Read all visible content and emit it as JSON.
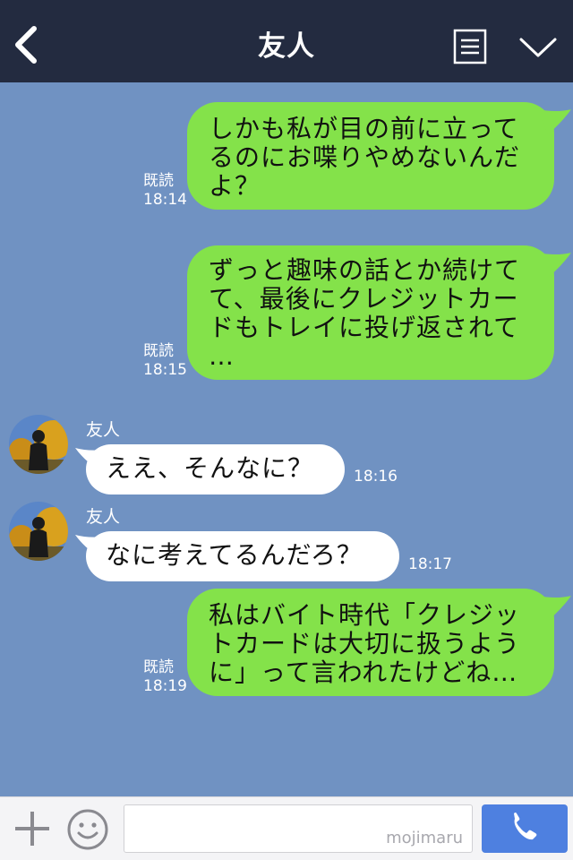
{
  "header": {
    "title": "友人"
  },
  "messages": [
    {
      "type": "sent",
      "text": "しかも私が目の前に立って\nるのにお喋りやめないんだ\nよ？",
      "read": "既読",
      "time": "18:14"
    },
    {
      "type": "sent",
      "text": "ずっと趣味の話とか続けて\nて、最後にクレジットカー\nドもトレイに投げ返されて\n…",
      "read": "既読",
      "time": "18:15"
    },
    {
      "type": "received",
      "sender": "友人",
      "text": "ええ、そんなに？",
      "time": "18:16"
    },
    {
      "type": "received",
      "sender": "友人",
      "text": "なに考えてるんだろ？",
      "time": "18:17"
    },
    {
      "type": "sent",
      "text": "私はバイト時代「クレジッ\nトカードは大切に扱うよう\nに」って言われたけどね…",
      "read": "既読",
      "time": "18:19"
    }
  ],
  "footer": {
    "watermark": "mojimaru"
  },
  "colors": {
    "header_bg": "#232b40",
    "chat_bg": "#7092c2",
    "sent_bubble": "#84e24a",
    "received_bubble": "#ffffff",
    "call_button": "#4e80e0"
  }
}
